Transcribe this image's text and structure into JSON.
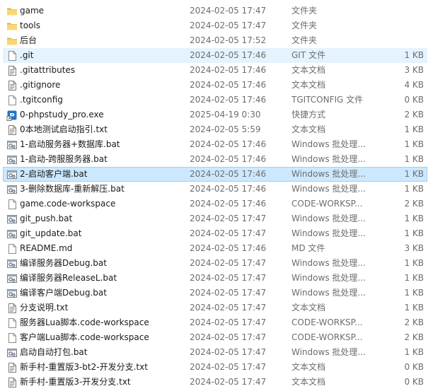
{
  "files": [
    {
      "name": "game",
      "date": "2024-02-05 17:47",
      "type": "文件夹",
      "size": "",
      "icon": "folder-icon",
      "state": ""
    },
    {
      "name": "tools",
      "date": "2024-02-05 17:47",
      "type": "文件夹",
      "size": "",
      "icon": "folder-icon",
      "state": ""
    },
    {
      "name": "后台",
      "date": "2024-02-05 17:52",
      "type": "文件夹",
      "size": "",
      "icon": "folder-icon",
      "state": ""
    },
    {
      "name": ".git",
      "date": "2024-02-05 17:46",
      "type": "GIT 文件",
      "size": "1 KB",
      "icon": "blank-file-icon",
      "state": "hover"
    },
    {
      "name": ".gitattributes",
      "date": "2024-02-05 17:46",
      "type": "文本文档",
      "size": "3 KB",
      "icon": "text-file-icon",
      "state": ""
    },
    {
      "name": ".gitignore",
      "date": "2024-02-05 17:46",
      "type": "文本文档",
      "size": "4 KB",
      "icon": "text-file-icon",
      "state": ""
    },
    {
      "name": ".tgitconfig",
      "date": "2024-02-05 17:46",
      "type": "TGITCONFIG 文件",
      "size": "0 KB",
      "icon": "blank-file-icon",
      "state": ""
    },
    {
      "name": "0-phpstudy_pro.exe",
      "date": "2025-04-19 0:30",
      "type": "快捷方式",
      "size": "2 KB",
      "icon": "shortcut-icon",
      "state": ""
    },
    {
      "name": "0本地测试启动指引.txt",
      "date": "2024-02-05 5:59",
      "type": "文本文档",
      "size": "1 KB",
      "icon": "text-file-icon",
      "state": ""
    },
    {
      "name": "1-启动服务器+数据库.bat",
      "date": "2024-02-05 17:46",
      "type": "Windows 批处理...",
      "size": "1 KB",
      "icon": "batch-file-icon",
      "state": ""
    },
    {
      "name": "1-启动-跨服服务器.bat",
      "date": "2024-02-05 17:46",
      "type": "Windows 批处理...",
      "size": "1 KB",
      "icon": "batch-file-icon",
      "state": ""
    },
    {
      "name": "2-启动客户端.bat",
      "date": "2024-02-05 17:46",
      "type": "Windows 批处理...",
      "size": "1 KB",
      "icon": "batch-file-icon",
      "state": "selected"
    },
    {
      "name": "3-删除数据库-重新解压.bat",
      "date": "2024-02-05 17:46",
      "type": "Windows 批处理...",
      "size": "1 KB",
      "icon": "batch-file-icon",
      "state": ""
    },
    {
      "name": "game.code-workspace",
      "date": "2024-02-05 17:46",
      "type": "CODE-WORKSP...",
      "size": "2 KB",
      "icon": "blank-file-icon",
      "state": ""
    },
    {
      "name": "git_push.bat",
      "date": "2024-02-05 17:47",
      "type": "Windows 批处理...",
      "size": "1 KB",
      "icon": "batch-file-icon",
      "state": ""
    },
    {
      "name": "git_update.bat",
      "date": "2024-02-05 17:47",
      "type": "Windows 批处理...",
      "size": "1 KB",
      "icon": "batch-file-icon",
      "state": ""
    },
    {
      "name": "README.md",
      "date": "2024-02-05 17:46",
      "type": "MD 文件",
      "size": "3 KB",
      "icon": "blank-file-icon",
      "state": ""
    },
    {
      "name": "编译服务器Debug.bat",
      "date": "2024-02-05 17:47",
      "type": "Windows 批处理...",
      "size": "1 KB",
      "icon": "batch-file-icon",
      "state": ""
    },
    {
      "name": "编译服务器ReleaseL.bat",
      "date": "2024-02-05 17:47",
      "type": "Windows 批处理...",
      "size": "1 KB",
      "icon": "batch-file-icon",
      "state": ""
    },
    {
      "name": "编译客户端Debug.bat",
      "date": "2024-02-05 17:47",
      "type": "Windows 批处理...",
      "size": "1 KB",
      "icon": "batch-file-icon",
      "state": ""
    },
    {
      "name": "分支说明.txt",
      "date": "2024-02-05 17:47",
      "type": "文本文档",
      "size": "1 KB",
      "icon": "text-file-icon",
      "state": ""
    },
    {
      "name": "服务器Lua脚本.code-workspace",
      "date": "2024-02-05 17:47",
      "type": "CODE-WORKSP...",
      "size": "2 KB",
      "icon": "blank-file-icon",
      "state": ""
    },
    {
      "name": "客户端Lua脚本.code-workspace",
      "date": "2024-02-05 17:47",
      "type": "CODE-WORKSP...",
      "size": "2 KB",
      "icon": "blank-file-icon",
      "state": ""
    },
    {
      "name": "启动自动打包.bat",
      "date": "2024-02-05 17:47",
      "type": "Windows 批处理...",
      "size": "1 KB",
      "icon": "batch-file-icon",
      "state": ""
    },
    {
      "name": "新手村-重置版3-bt2-开发分支.txt",
      "date": "2024-02-05 17:47",
      "type": "文本文档",
      "size": "0 KB",
      "icon": "text-file-icon",
      "state": ""
    },
    {
      "name": "新手村-重置版3-开发分支.txt",
      "date": "2024-02-05 17:47",
      "type": "文本文档",
      "size": "0 KB",
      "icon": "text-file-icon",
      "state": ""
    }
  ]
}
